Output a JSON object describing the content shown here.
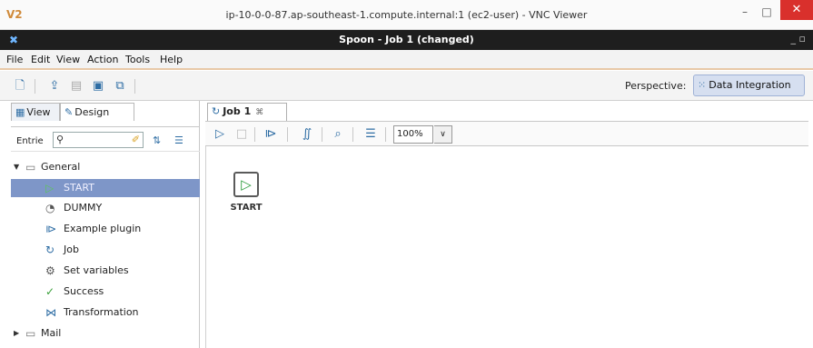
{
  "vnc": {
    "logo": "V2",
    "title": "ip-10-0-0-87.ap-southeast-1.compute.internal:1 (ec2-user) - VNC Viewer",
    "minimize": "–",
    "maximize": "□",
    "close": "✕"
  },
  "window": {
    "title": "Spoon - Job 1 (changed)",
    "controls": "_ ▫"
  },
  "menu": {
    "items": [
      "File",
      "Edit",
      "View",
      "Action",
      "Tools",
      "Help"
    ]
  },
  "toolbar": {
    "perspective_label": "Perspective:",
    "perspective_value": "Data Integration",
    "icons": [
      "new-file-icon",
      "explore-icon",
      "open-icon",
      "save-icon",
      "save-as-icon"
    ]
  },
  "left_panel": {
    "tabs": [
      {
        "label": "View",
        "icon": "view-icon"
      },
      {
        "label": "Design",
        "icon": "design-icon"
      }
    ],
    "search_label": "Entrie",
    "tree": [
      {
        "label": "General",
        "type": "folder",
        "expanded": true
      },
      {
        "label": "START",
        "type": "entry",
        "selected": true
      },
      {
        "label": "DUMMY",
        "type": "entry"
      },
      {
        "label": "Example plugin",
        "type": "entry"
      },
      {
        "label": "Job",
        "type": "entry"
      },
      {
        "label": "Set variables",
        "type": "entry"
      },
      {
        "label": "Success",
        "type": "entry"
      },
      {
        "label": "Transformation",
        "type": "entry"
      },
      {
        "label": "Mail",
        "type": "folder",
        "expanded": false
      }
    ]
  },
  "job": {
    "tab_label": "Job 1",
    "tab_close": "⌘",
    "zoom": "100%",
    "node_label": "START"
  }
}
